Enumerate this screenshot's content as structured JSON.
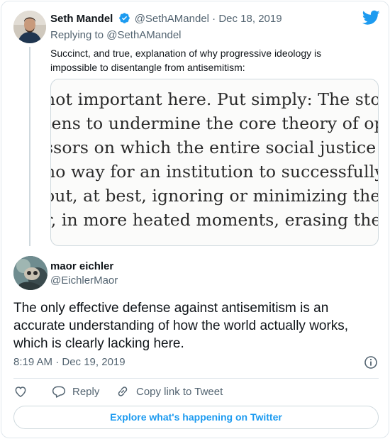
{
  "brand": {
    "twitter_blue": "#1d9bf0",
    "verified_blue": "#1d9bf0",
    "heart_color": "#536471"
  },
  "parent_tweet": {
    "author_name": "Seth Mandel",
    "verified": true,
    "handle": "@SethAMandel",
    "separator": "·",
    "date": "Dec 18, 2019",
    "replying_to_prefix": "Replying to ",
    "replying_to_handle": "@SethAMandel",
    "text": "Succinct, and true, explanation of why progressive ideology is impossible to disentangle from antisemitism:",
    "media_lines": [
      "not important here. Put simply: The story of",
      "tens to undermine the core theory of oppress",
      "ssors on which the entire social justice move",
      "no way for an institution to successfully em",
      "out, at best, ignoring or minimizing the Jewi",
      "r, in more heated moments, erasing them en"
    ]
  },
  "main_tweet": {
    "author_name": "maor eichler",
    "handle": "@EichlerMaor",
    "text": "The only effective defense against antisemitism is an accurate understanding of how the world actually works, which is clearly lacking here.",
    "timestamp": "8:19 AM · Dec 19, 2019"
  },
  "actions": {
    "reply_label": "Reply",
    "copy_link_label": "Copy link to Tweet"
  },
  "explore_button": "Explore what's happening on Twitter",
  "icons": [
    "verified-badge-icon",
    "twitter-bird-icon",
    "info-icon",
    "heart-icon",
    "reply-icon",
    "link-icon"
  ]
}
